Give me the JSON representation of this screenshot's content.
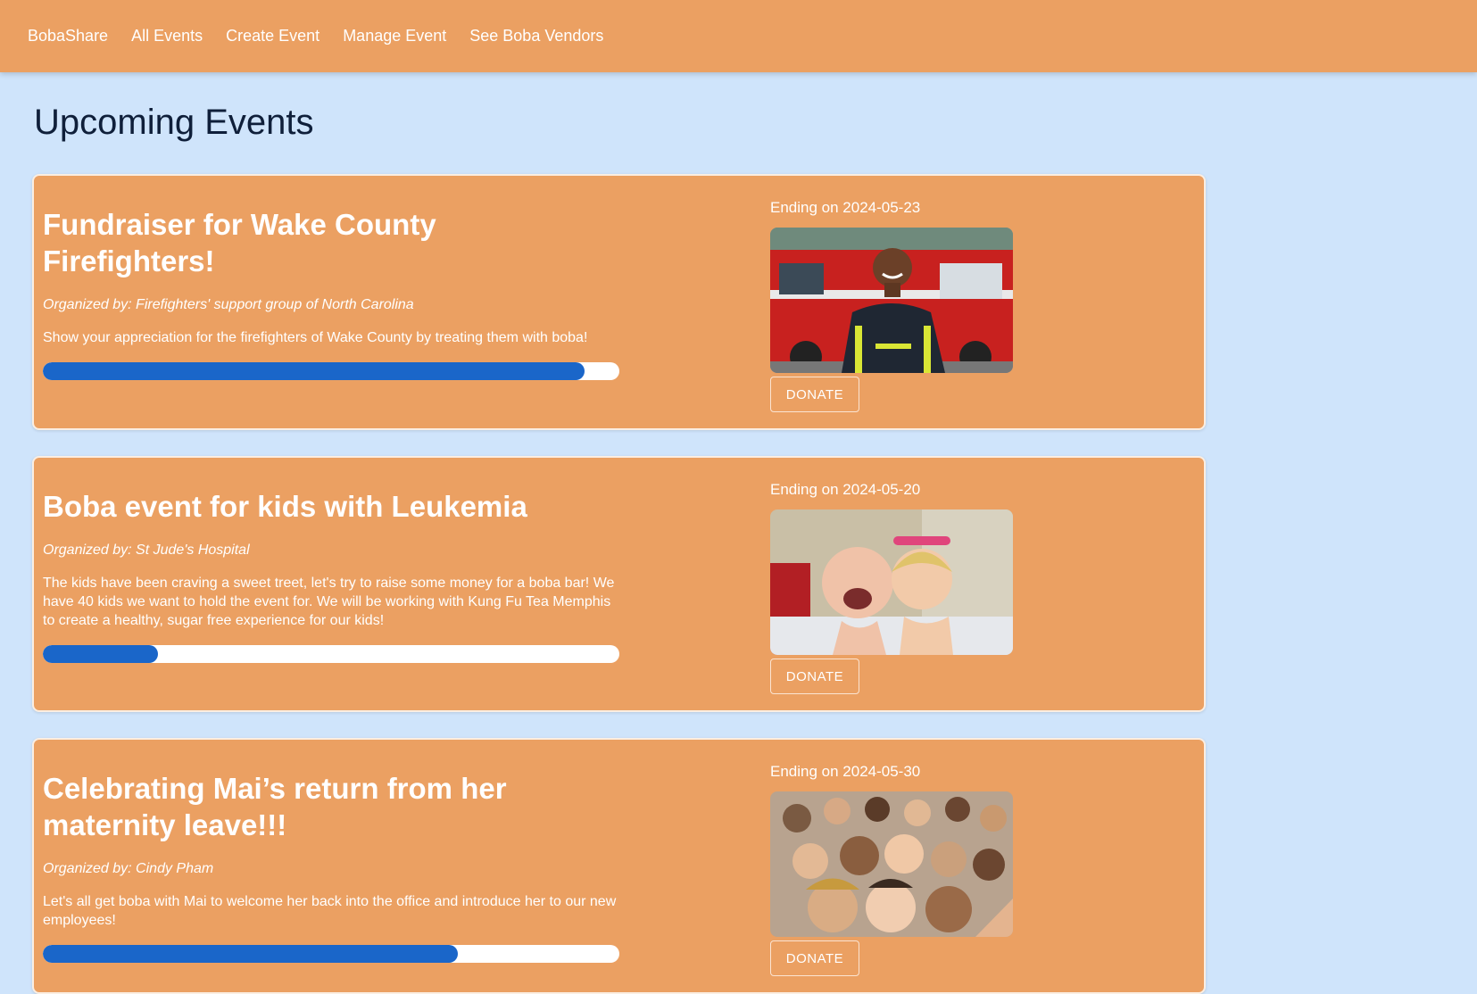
{
  "nav": {
    "brand": "BobaShare",
    "items": [
      "All Events",
      "Create Event",
      "Manage Event",
      "See Boba Vendors"
    ]
  },
  "page": {
    "title": "Upcoming Events"
  },
  "events": [
    {
      "title": "Fundraiser for Wake County Firefighters!",
      "organizer": "Organized by: Firefighters' support group of North Carolina",
      "description": "Show your appreciation for the firefighters of Wake County by treating them with boba!",
      "ending": "Ending on 2024-05-23",
      "progress": 0.94,
      "donate_label": "DONATE",
      "image": "firefighter-photo"
    },
    {
      "title": "Boba event for kids with Leukemia",
      "organizer": "Organized by: St Jude's Hospital",
      "description": "The kids have been craving a sweet treet, let's try to raise some money for a boba bar! We have 40 kids we want to hold the event for. We will be working with Kung Fu Tea Memphis to create a healthy, sugar free experience for our kids!",
      "ending": "Ending on 2024-05-20",
      "progress": 0.2,
      "donate_label": "DONATE",
      "image": "kids-photo"
    },
    {
      "title": "Celebrating Mai’s return from her maternity leave!!!",
      "organizer": "Organized by: Cindy Pham",
      "description": "Let's all get boba with Mai to welcome her back into the office and introduce her to our new employees!",
      "ending": "Ending on 2024-05-30",
      "progress": 0.72,
      "donate_label": "DONATE",
      "image": "group-selfie-photo"
    }
  ],
  "colors": {
    "nav": "#eba062",
    "card": "#eba062",
    "background": "#cfe4fb",
    "progress": "#1a66c9"
  }
}
